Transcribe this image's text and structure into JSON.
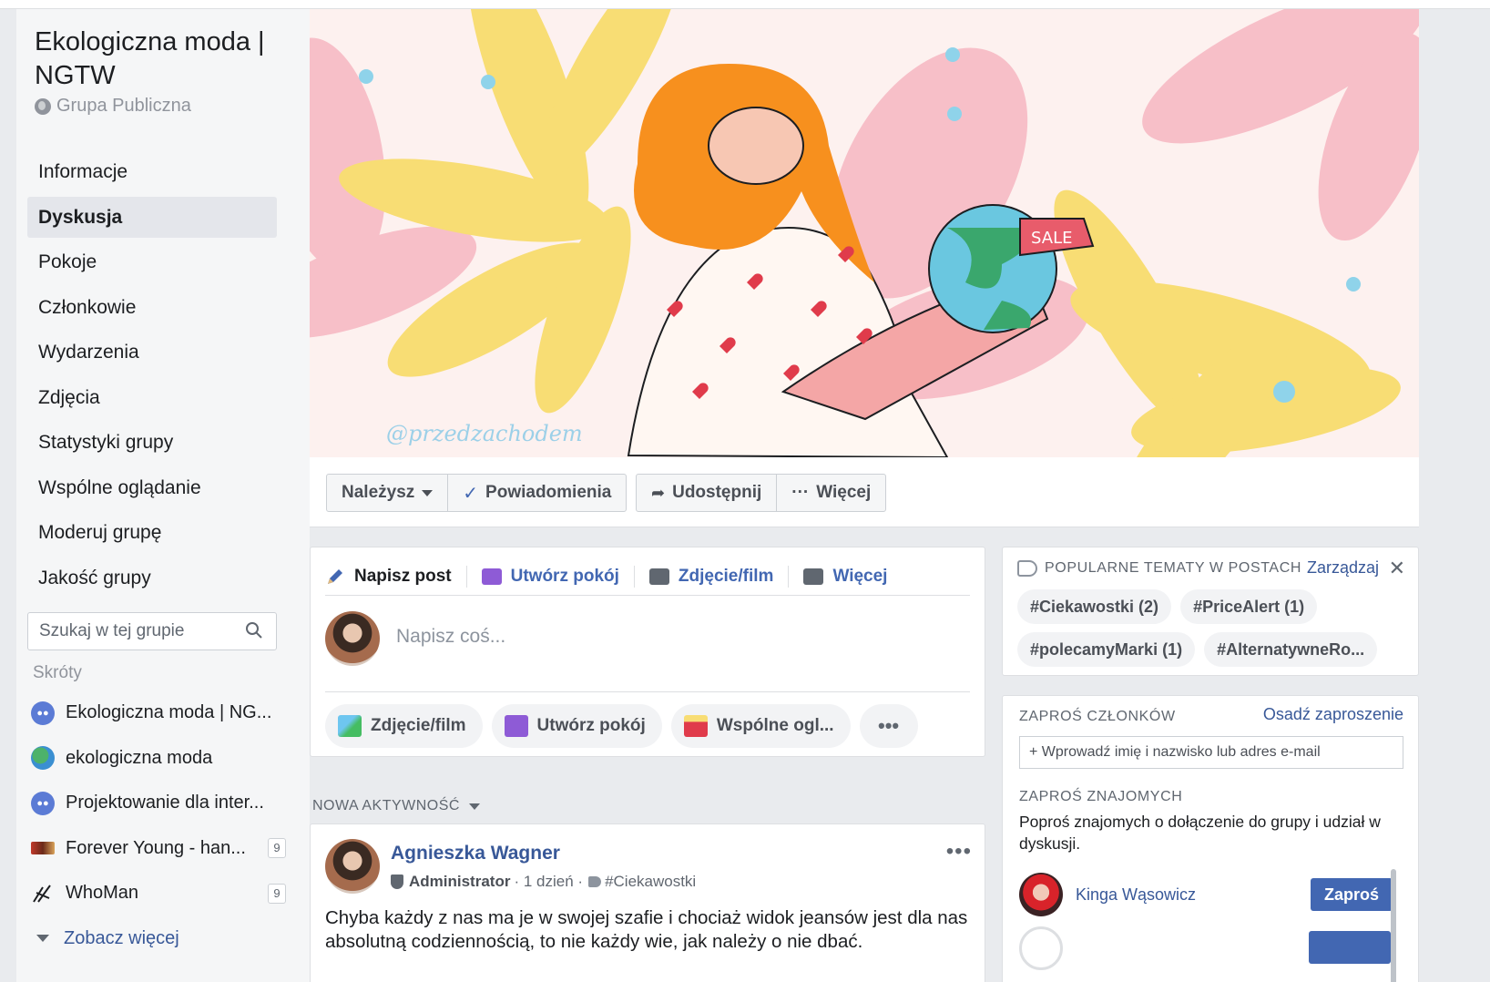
{
  "group": {
    "title": "Ekologiczna moda | NGTW",
    "type": "Grupa Publiczna"
  },
  "nav": {
    "items": [
      "Informacje",
      "Dyskusja",
      "Pokoje",
      "Członkowie",
      "Wydarzenia",
      "Zdjęcia",
      "Statystyki grupy",
      "Wspólne oglądanie",
      "Moderuj grupę",
      "Jakość grupy"
    ],
    "active": "Dyskusja"
  },
  "search": {
    "placeholder": "Szukaj w tej grupie"
  },
  "shortcuts": {
    "heading": "Skróty",
    "items": [
      {
        "label": "Ekologiczna moda | NG...",
        "icon": "group-icon",
        "badge": ""
      },
      {
        "label": "ekologiczna moda",
        "icon": "globe-icon",
        "badge": ""
      },
      {
        "label": "Projektowanie dla inter...",
        "icon": "group-icon",
        "badge": ""
      },
      {
        "label": "Forever Young - han...",
        "icon": "page-thumbnail",
        "badge": "9"
      },
      {
        "label": "WhoMan",
        "icon": "whoman-logo",
        "badge": "9"
      }
    ],
    "see_more": "Zobacz więcej"
  },
  "cover": {
    "signature": "@przedzachodem",
    "tag_text": "SALE"
  },
  "actions": {
    "joined": "Należysz",
    "notifications": "Powiadomienia",
    "share": "Udostępnij",
    "more": "Więcej",
    "more_prefix": "···"
  },
  "composer": {
    "tabs": [
      "Napisz post",
      "Utwórz pokój",
      "Zdjęcie/film",
      "Więcej"
    ],
    "placeholder": "Napisz coś...",
    "buttons": [
      "Zdjęcie/film",
      "Utwórz pokój",
      "Wspólne ogl..."
    ],
    "more": "•••"
  },
  "feed": {
    "heading": "NOWA AKTYWNOŚĆ"
  },
  "post": {
    "author": "Agnieszka Wagner",
    "role": "Administrator",
    "time": "· 1 dzień ·",
    "topic": "#Ciekawostki",
    "menu": "•••",
    "text": "Chyba każdy z nas ma je w swojej szafie i chociaż widok jeansów jest dla nas absolutną codziennością, to nie każdy wie, jak należy o nie dbać."
  },
  "topics": {
    "heading": "POPULARNE TEMATY W POSTACH",
    "manage": "Zarządzaj",
    "close": "✕",
    "chips": [
      "#Ciekawostki (2)",
      "#PriceAlert (1)",
      "#polecamyMarki (1)",
      "#AlternatywneRo..."
    ]
  },
  "invite": {
    "heading": "ZAPROŚ CZŁONKÓW",
    "embed": "Osadź zaproszenie",
    "input_placeholder": "+ Wprowadź imię i nazwisko lub adres e-mail",
    "friends_heading": "ZAPROŚ ZNAJOMYCH",
    "friends_text": "Poproś znajomych o dołączenie do grupy i udział w dyskusji.",
    "friends": [
      {
        "name": "Kinga Wąsowicz",
        "button": "Zaproś"
      }
    ]
  },
  "colors": {
    "brand_blue": "#4267b2",
    "link_blue": "#385898",
    "background": "#e9ebee",
    "cover_pink": "#f7bfc8",
    "cover_yellow": "#f8dd74",
    "hair_orange": "#f7901e",
    "globe_green": "#3aa76d"
  }
}
